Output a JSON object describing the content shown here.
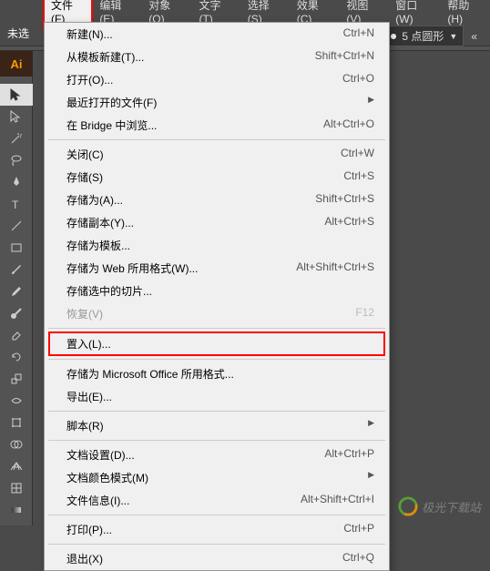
{
  "menubar": {
    "items": [
      {
        "label": "文件(F)"
      },
      {
        "label": "编辑(E)"
      },
      {
        "label": "对象(O)"
      },
      {
        "label": "文字(T)"
      },
      {
        "label": "选择(S)"
      },
      {
        "label": "效果(C)"
      },
      {
        "label": "视图(V)"
      },
      {
        "label": "窗口(W)"
      },
      {
        "label": "帮助(H)"
      }
    ]
  },
  "toolbar": {
    "status": "未选"
  },
  "stroke_preset": {
    "label": "5 点圆形"
  },
  "dropdown": [
    {
      "type": "item",
      "label": "新建(N)...",
      "shortcut": "Ctrl+N"
    },
    {
      "type": "item",
      "label": "从模板新建(T)...",
      "shortcut": "Shift+Ctrl+N"
    },
    {
      "type": "item",
      "label": "打开(O)...",
      "shortcut": "Ctrl+O"
    },
    {
      "type": "item",
      "label": "最近打开的文件(F)",
      "submenu": true
    },
    {
      "type": "item",
      "label": "在 Bridge 中浏览...",
      "shortcut": "Alt+Ctrl+O"
    },
    {
      "type": "sep"
    },
    {
      "type": "item",
      "label": "关闭(C)",
      "shortcut": "Ctrl+W"
    },
    {
      "type": "item",
      "label": "存储(S)",
      "shortcut": "Ctrl+S"
    },
    {
      "type": "item",
      "label": "存储为(A)...",
      "shortcut": "Shift+Ctrl+S"
    },
    {
      "type": "item",
      "label": "存储副本(Y)...",
      "shortcut": "Alt+Ctrl+S"
    },
    {
      "type": "item",
      "label": "存储为模板..."
    },
    {
      "type": "item",
      "label": "存储为 Web 所用格式(W)...",
      "shortcut": "Alt+Shift+Ctrl+S"
    },
    {
      "type": "item",
      "label": "存储选中的切片..."
    },
    {
      "type": "item",
      "label": "恢复(V)",
      "shortcut": "F12",
      "disabled": true
    },
    {
      "type": "sep"
    },
    {
      "type": "item",
      "label": "置入(L)...",
      "boxed": true
    },
    {
      "type": "sep"
    },
    {
      "type": "item",
      "label": "存储为 Microsoft Office 所用格式..."
    },
    {
      "type": "item",
      "label": "导出(E)..."
    },
    {
      "type": "sep"
    },
    {
      "type": "item",
      "label": "脚本(R)",
      "submenu": true
    },
    {
      "type": "sep"
    },
    {
      "type": "item",
      "label": "文档设置(D)...",
      "shortcut": "Alt+Ctrl+P"
    },
    {
      "type": "item",
      "label": "文档颜色模式(M)",
      "submenu": true
    },
    {
      "type": "item",
      "label": "文件信息(I)...",
      "shortcut": "Alt+Shift+Ctrl+I"
    },
    {
      "type": "sep"
    },
    {
      "type": "item",
      "label": "打印(P)...",
      "shortcut": "Ctrl+P"
    },
    {
      "type": "sep"
    },
    {
      "type": "item",
      "label": "退出(X)",
      "shortcut": "Ctrl+Q"
    }
  ],
  "tools": [
    {
      "name": "ai-logo"
    },
    {
      "name": "spacer"
    },
    {
      "name": "selection-tool",
      "highlighted": true
    },
    {
      "name": "direct-selection-tool"
    },
    {
      "name": "magic-wand-tool"
    },
    {
      "name": "lasso-tool"
    },
    {
      "name": "pen-tool"
    },
    {
      "name": "type-tool"
    },
    {
      "name": "line-tool"
    },
    {
      "name": "rectangle-tool"
    },
    {
      "name": "paintbrush-tool"
    },
    {
      "name": "pencil-tool"
    },
    {
      "name": "blob-brush-tool"
    },
    {
      "name": "eraser-tool"
    },
    {
      "name": "rotate-tool"
    },
    {
      "name": "scale-tool"
    },
    {
      "name": "width-tool"
    },
    {
      "name": "free-transform-tool"
    },
    {
      "name": "shape-builder-tool"
    },
    {
      "name": "perspective-grid-tool"
    },
    {
      "name": "mesh-tool"
    },
    {
      "name": "gradient-tool"
    }
  ],
  "watermark": {
    "text": "极光下载站"
  }
}
